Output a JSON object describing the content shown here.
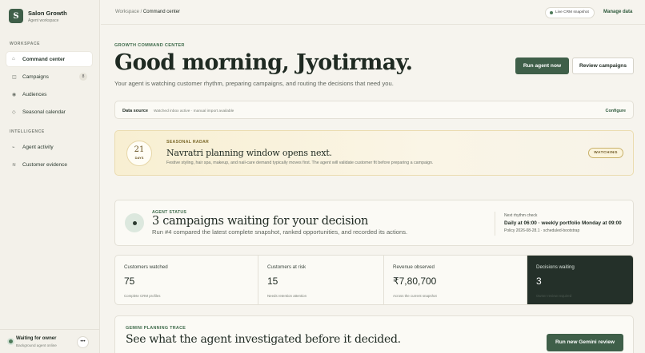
{
  "brand": {
    "logo_letter": "S",
    "name": "Salon Growth",
    "subtitle": "Agent workspace"
  },
  "sidebar": {
    "workspace_label": "WORKSPACE",
    "workspace_items": [
      {
        "label": "Command center",
        "icon": "home-icon",
        "glyph": "⌂",
        "active": true
      },
      {
        "label": "Campaigns",
        "icon": "campaign-icon",
        "glyph": "◫",
        "badge": "8"
      },
      {
        "label": "Audiences",
        "icon": "audience-icon",
        "glyph": "◉"
      },
      {
        "label": "Seasonal calendar",
        "icon": "calendar-icon",
        "glyph": "◇"
      }
    ],
    "intelligence_label": "INTELLIGENCE",
    "intelligence_items": [
      {
        "label": "Agent activity",
        "icon": "activity-icon",
        "glyph": "⌁"
      },
      {
        "label": "Customer evidence",
        "icon": "evidence-icon",
        "glyph": "≋"
      }
    ]
  },
  "owner": {
    "title": "Waiting for owner",
    "subtitle": "Background agent online",
    "more": "•••"
  },
  "topbar": {
    "breadcrumb_root": "Workspace",
    "breadcrumb_sep": " / ",
    "breadcrumb_current": "Command center",
    "live_pill": "Live CRM snapshot",
    "manage_link": "Manage data"
  },
  "hero": {
    "eyebrow": "GROWTH COMMAND CENTER",
    "title": "Good morning, Jyotirmay.",
    "subtitle": "Your agent is watching customer rhythm, preparing campaigns, and routing the decisions that need you.",
    "run_button": "Run agent now",
    "review_button": "Review campaigns"
  },
  "data_source": {
    "label": "Data source",
    "text": "Watched inbox active · manual import available",
    "link": "Configure"
  },
  "seasonal": {
    "day_number": "21",
    "day_unit": "DAYS",
    "eyebrow": "SEASONAL RADAR",
    "title": "Navratri planning window opens next.",
    "description": "Festive styling, hair spa, makeup, and nail-care demand typically moves first. The agent will validate customer fit before preparing a campaign.",
    "badge": "WATCHING"
  },
  "agent_status": {
    "eyebrow": "AGENT STATUS",
    "title": "3 campaigns waiting for your decision",
    "subtitle": "Run #4 compared the latest complete snapshot, ranked opportunities, and recorded its actions.",
    "rhythm_label": "Next rhythm check",
    "rhythm_value": "Daily at 06:00 · weekly portfolio Monday at 09:00",
    "policy": "Policy 2026-08-28.1 · scheduled-bootstrap"
  },
  "metrics": [
    {
      "label": "Customers watched",
      "value": "75",
      "note": "Complete CRM profiles"
    },
    {
      "label": "Customers at risk",
      "value": "15",
      "note": "Needs retention attention"
    },
    {
      "label": "Revenue observed",
      "value": "₹7,80,700",
      "note": "Across the current snapshot"
    },
    {
      "label": "Decisions waiting",
      "value": "3",
      "note": "Owner review required"
    }
  ],
  "trace": {
    "eyebrow": "GEMINI PLANNING TRACE",
    "title": "See what the agent investigated before it decided.",
    "button": "Run new Gemini review"
  },
  "colors": {
    "accent": "#3f5f49",
    "dark_panel": "#243029",
    "seasonal_tint": "#f8efd2"
  }
}
